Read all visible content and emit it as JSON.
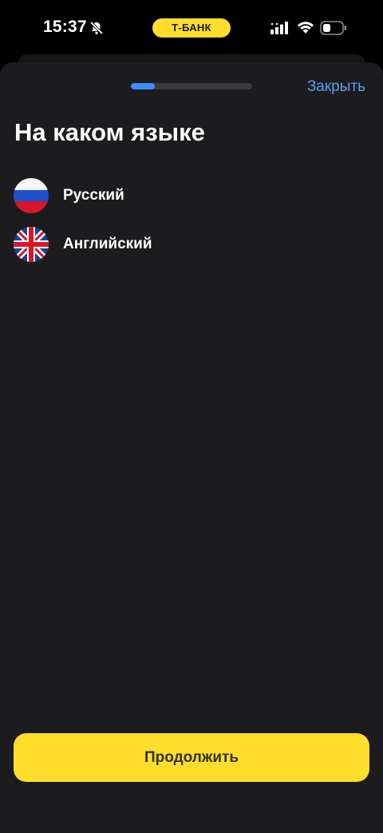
{
  "status_bar": {
    "time": "15:37",
    "bank_label": "Т‑БАНК",
    "icons": [
      "bell-slash-icon",
      "signal-icon",
      "wifi-icon",
      "battery-icon"
    ]
  },
  "header": {
    "close_label": "Закрыть",
    "progress": 0.2
  },
  "title": "На каком языке",
  "languages": [
    {
      "label": "Русский",
      "flag": "russia-flag-icon"
    },
    {
      "label": "Английский",
      "flag": "uk-flag-icon"
    }
  ],
  "continue_label": "Продолжить",
  "colors": {
    "accent_yellow": "#ffdd2d",
    "link_blue": "#5b9ef5",
    "progress_blue": "#428bf9",
    "sheet_bg": "#1c1c1e"
  }
}
